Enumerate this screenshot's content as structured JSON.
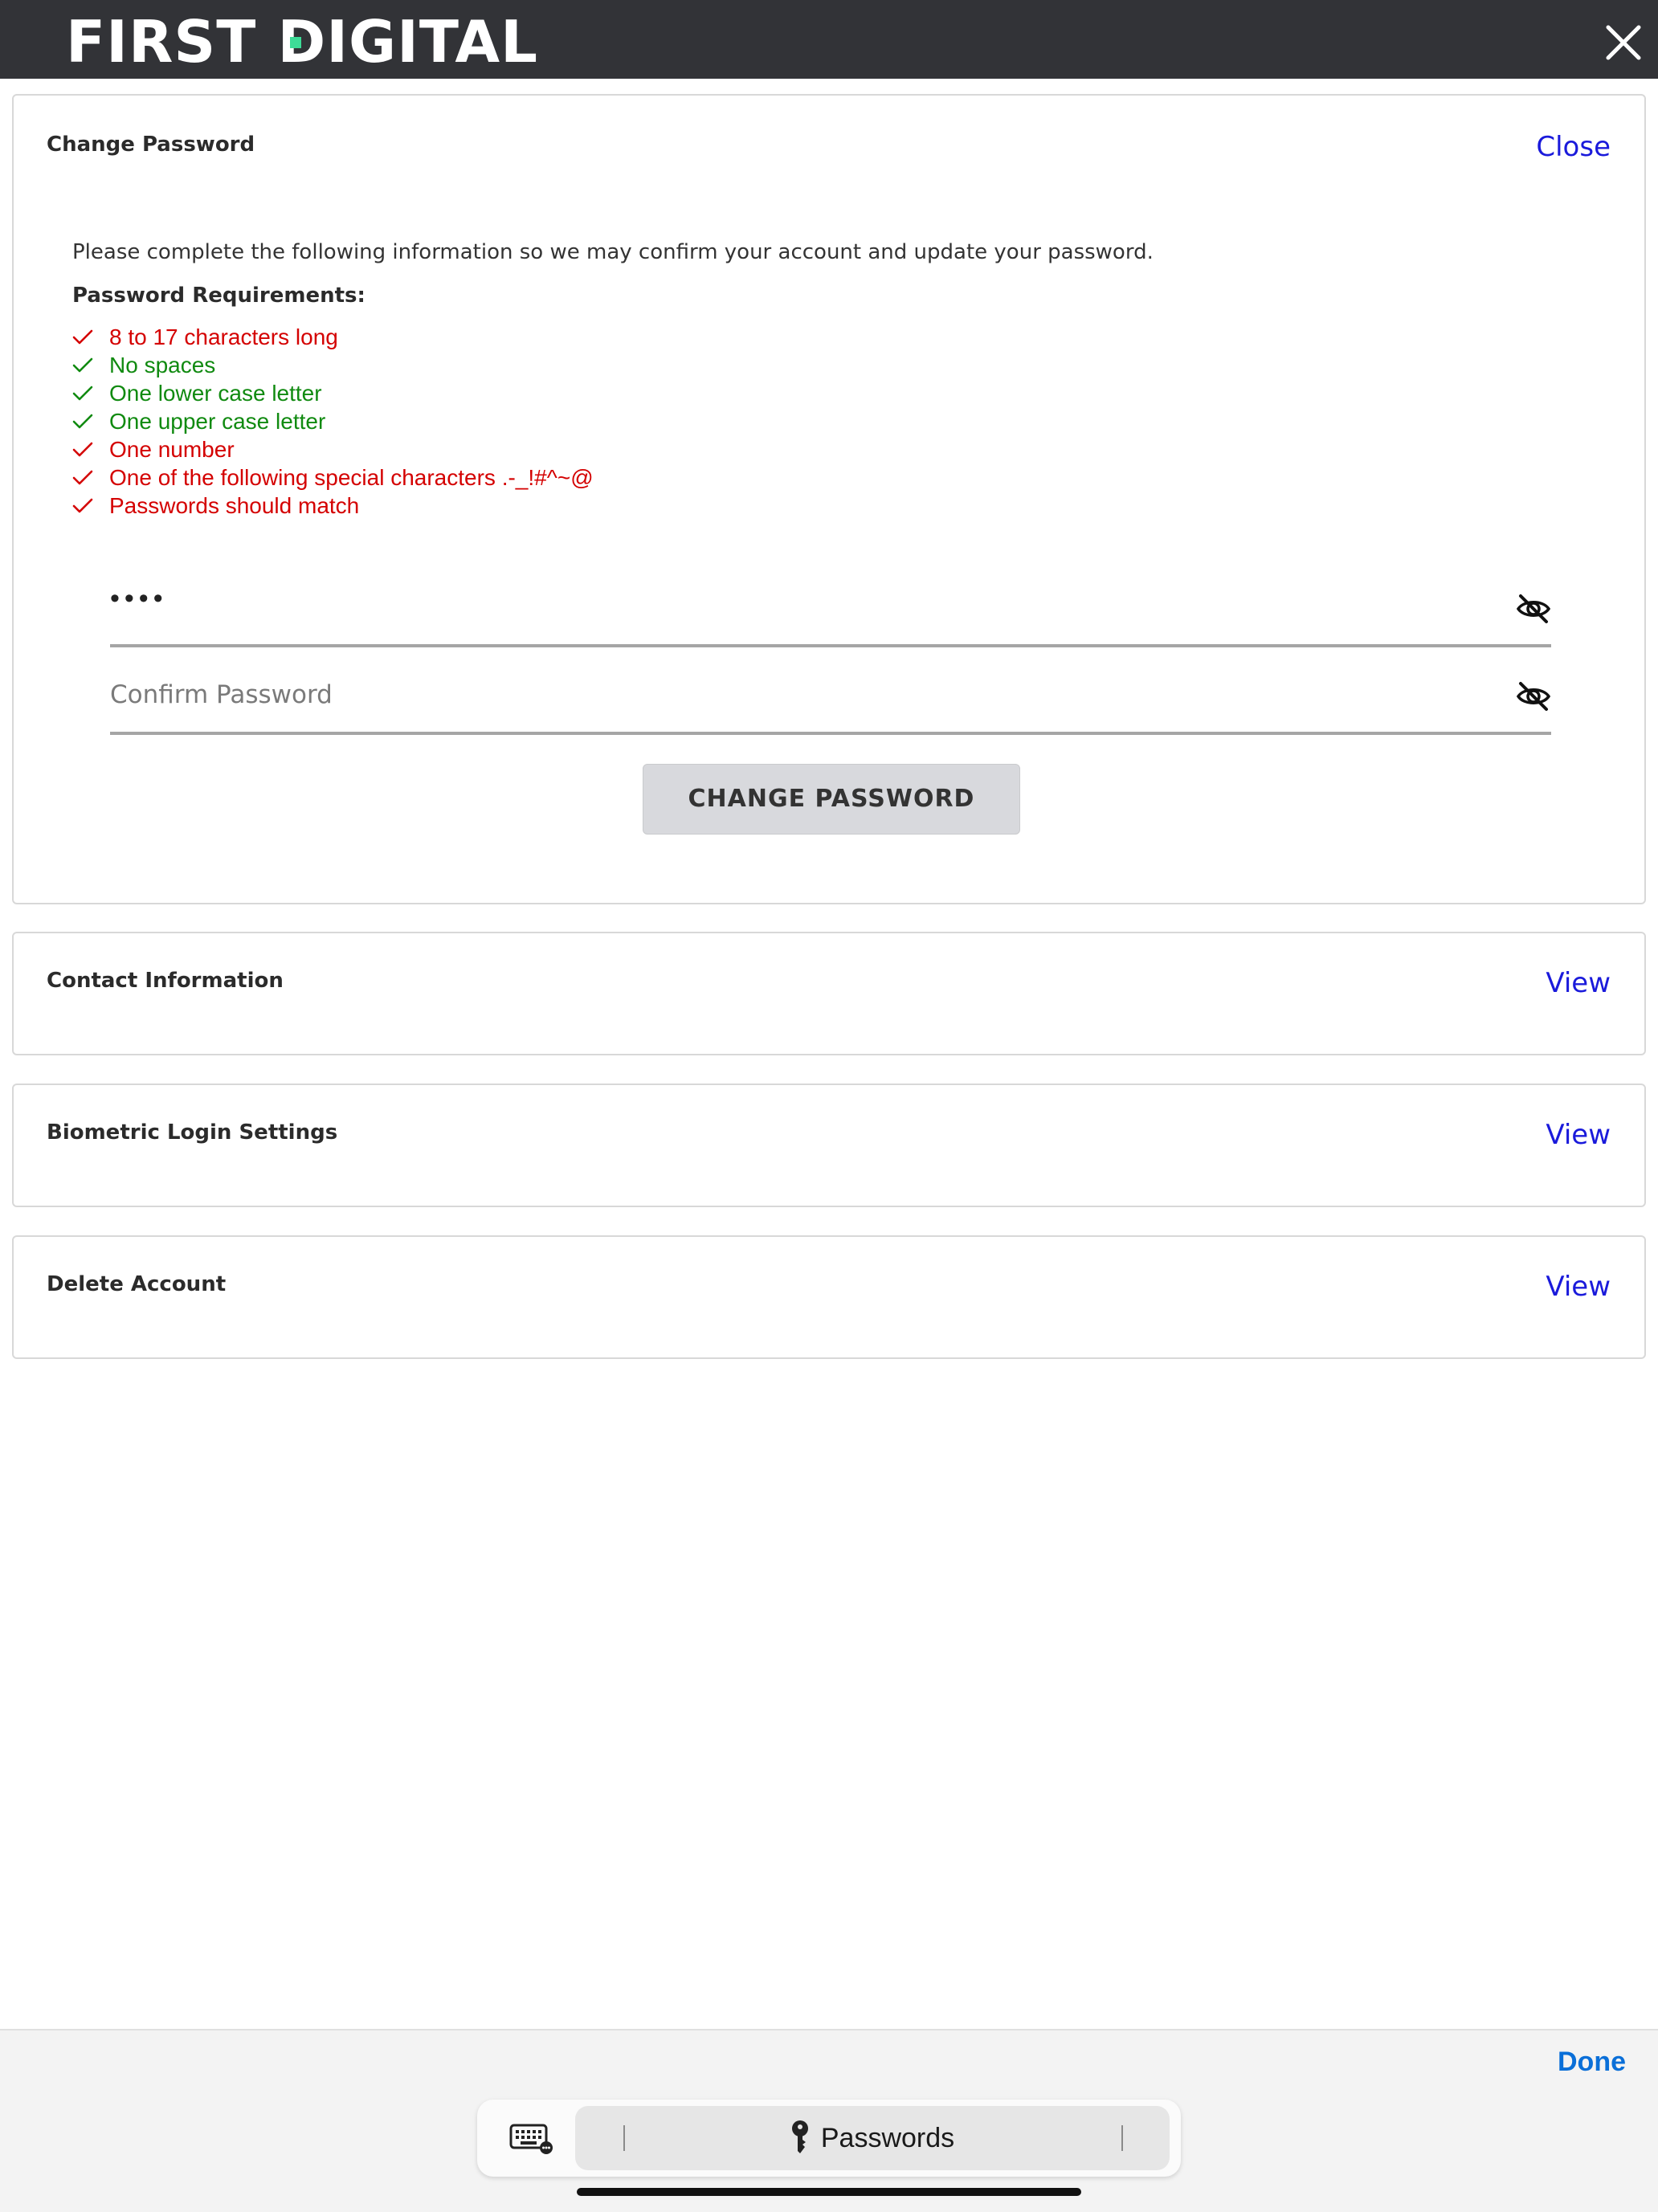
{
  "brand": {
    "part1": "FIRST ",
    "d": "D",
    "part2": "IGITAL",
    "accent": "#3ddc97"
  },
  "colors": {
    "link": "#1a1adb",
    "fail": "#d40000",
    "pass": "#108a10",
    "done": "#0a6fd8"
  },
  "change_password": {
    "title": "Change Password",
    "close_label": "Close",
    "intro": "Please complete the following information so we may confirm your account and update your password.",
    "requirements_title": "Password Requirements:",
    "requirements": [
      {
        "text": "8 to 17 characters long",
        "status": "fail"
      },
      {
        "text": "No spaces",
        "status": "pass"
      },
      {
        "text": "One lower case letter",
        "status": "pass"
      },
      {
        "text": "One upper case letter",
        "status": "pass"
      },
      {
        "text": "One number",
        "status": "fail"
      },
      {
        "text": "One of the following special characters .-_!#^~@",
        "status": "fail"
      },
      {
        "text": "Passwords should match",
        "status": "fail"
      }
    ],
    "password_value": "••••",
    "confirm_placeholder": "Confirm Password",
    "submit_label": "CHANGE PASSWORD"
  },
  "sections": [
    {
      "title": "Contact Information",
      "link": "View"
    },
    {
      "title": "Biometric Login Settings",
      "link": "View"
    },
    {
      "title": "Delete Account",
      "link": "View"
    }
  ],
  "keyboard_bar": {
    "done_label": "Done",
    "passwords_label": "Passwords"
  },
  "icons": [
    "close-icon",
    "eye-off-icon",
    "check-icon",
    "keyboard-icon",
    "key-icon"
  ]
}
